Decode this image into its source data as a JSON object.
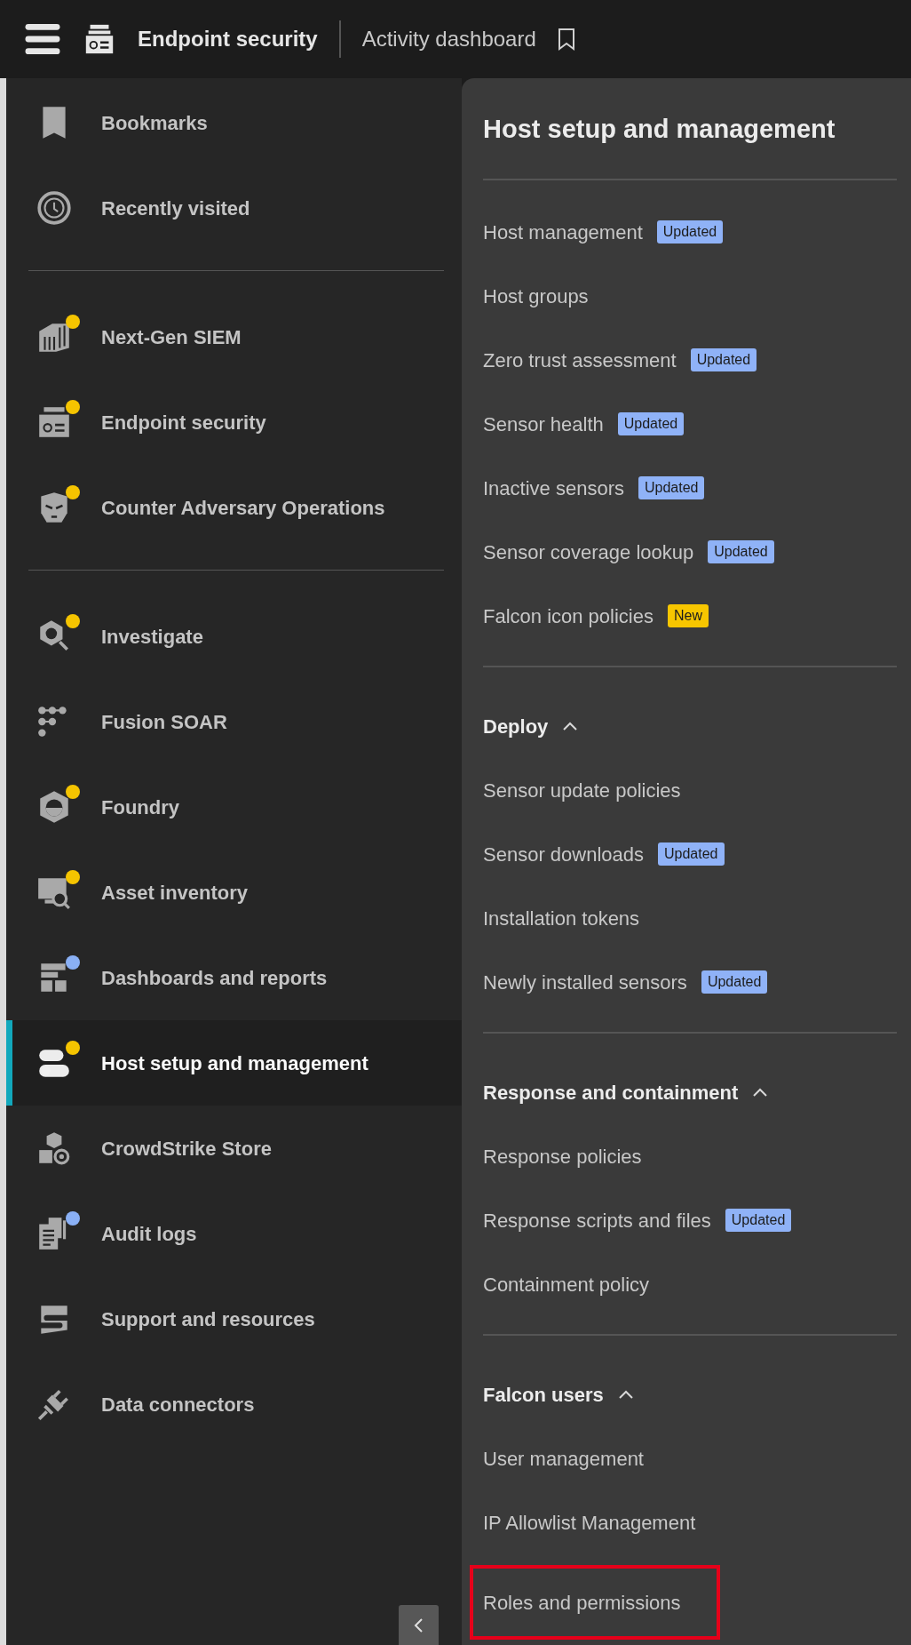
{
  "top_bar": {
    "app_title": "Endpoint security",
    "page_title": "Activity dashboard"
  },
  "sidebar": {
    "groups": [
      {
        "items": [
          {
            "label": "Bookmarks",
            "selected": false
          },
          {
            "label": "Recently visited",
            "selected": false
          }
        ]
      },
      {
        "items": [
          {
            "label": "Next-Gen SIEM",
            "selected": false,
            "color": "#f5c400"
          },
          {
            "label": "Endpoint security",
            "selected": false,
            "color": "#f5c400"
          },
          {
            "label": "Counter Adversary Operations",
            "selected": false,
            "color": "#f5c400"
          }
        ]
      },
      {
        "items": [
          {
            "label": "Investigate",
            "selected": false,
            "color": "#f5c400"
          },
          {
            "label": "Fusion SOAR",
            "selected": false
          },
          {
            "label": "Foundry",
            "selected": false,
            "color": "#f5c400"
          },
          {
            "label": "Asset inventory",
            "selected": false,
            "color": "#f5c400"
          },
          {
            "label": "Dashboards and reports",
            "selected": false,
            "color": "#8ab0f5"
          },
          {
            "label": "Host setup and management",
            "selected": true,
            "color": "#f5c400"
          },
          {
            "label": "CrowdStrike Store",
            "selected": false
          },
          {
            "label": "Audit logs",
            "selected": false,
            "color": "#8ab0f5"
          },
          {
            "label": "Support and resources",
            "selected": false
          },
          {
            "label": "Data connectors",
            "selected": false
          }
        ]
      }
    ]
  },
  "panel": {
    "title": "Host setup and management",
    "sections": [
      {
        "items": [
          {
            "label": "Host management",
            "badge": {
              "text": "Updated",
              "kind": "updated"
            },
            "outlined": false
          },
          {
            "label": "Host groups",
            "outlined": false
          },
          {
            "label": "Zero trust assessment",
            "badge": {
              "text": "Updated",
              "kind": "updated"
            },
            "outlined": false
          },
          {
            "label": "Sensor health",
            "badge": {
              "text": "Updated",
              "kind": "updated"
            },
            "outlined": false
          },
          {
            "label": "Inactive sensors",
            "badge": {
              "text": "Updated",
              "kind": "updated"
            },
            "outlined": false
          },
          {
            "label": "Sensor coverage lookup",
            "badge": {
              "text": "Updated",
              "kind": "updated"
            },
            "outlined": false
          },
          {
            "label": "Falcon icon policies",
            "badge": {
              "text": "New",
              "kind": "new"
            },
            "outlined": false
          }
        ]
      },
      {
        "heading": {
          "label": "Deploy",
          "expanded": true
        },
        "items": [
          {
            "label": "Sensor update policies",
            "outlined": false
          },
          {
            "label": "Sensor downloads",
            "badge": {
              "text": "Updated",
              "kind": "updated"
            },
            "outlined": false
          },
          {
            "label": "Installation tokens",
            "outlined": false
          },
          {
            "label": "Newly installed sensors",
            "badge": {
              "text": "Updated",
              "kind": "updated"
            },
            "outlined": false
          }
        ]
      },
      {
        "heading": {
          "label": "Response and containment",
          "expanded": true
        },
        "items": [
          {
            "label": "Response policies",
            "outlined": false
          },
          {
            "label": "Response scripts and files",
            "badge": {
              "text": "Updated",
              "kind": "updated"
            },
            "outlined": false
          },
          {
            "label": "Containment policy",
            "outlined": false
          }
        ]
      },
      {
        "heading": {
          "label": "Falcon users",
          "expanded": true
        },
        "items": [
          {
            "label": "User management",
            "outlined": false
          },
          {
            "label": "IP Allowlist Management",
            "outlined": false
          },
          {
            "label": "Roles and permissions",
            "outlined": true
          }
        ]
      }
    ]
  }
}
